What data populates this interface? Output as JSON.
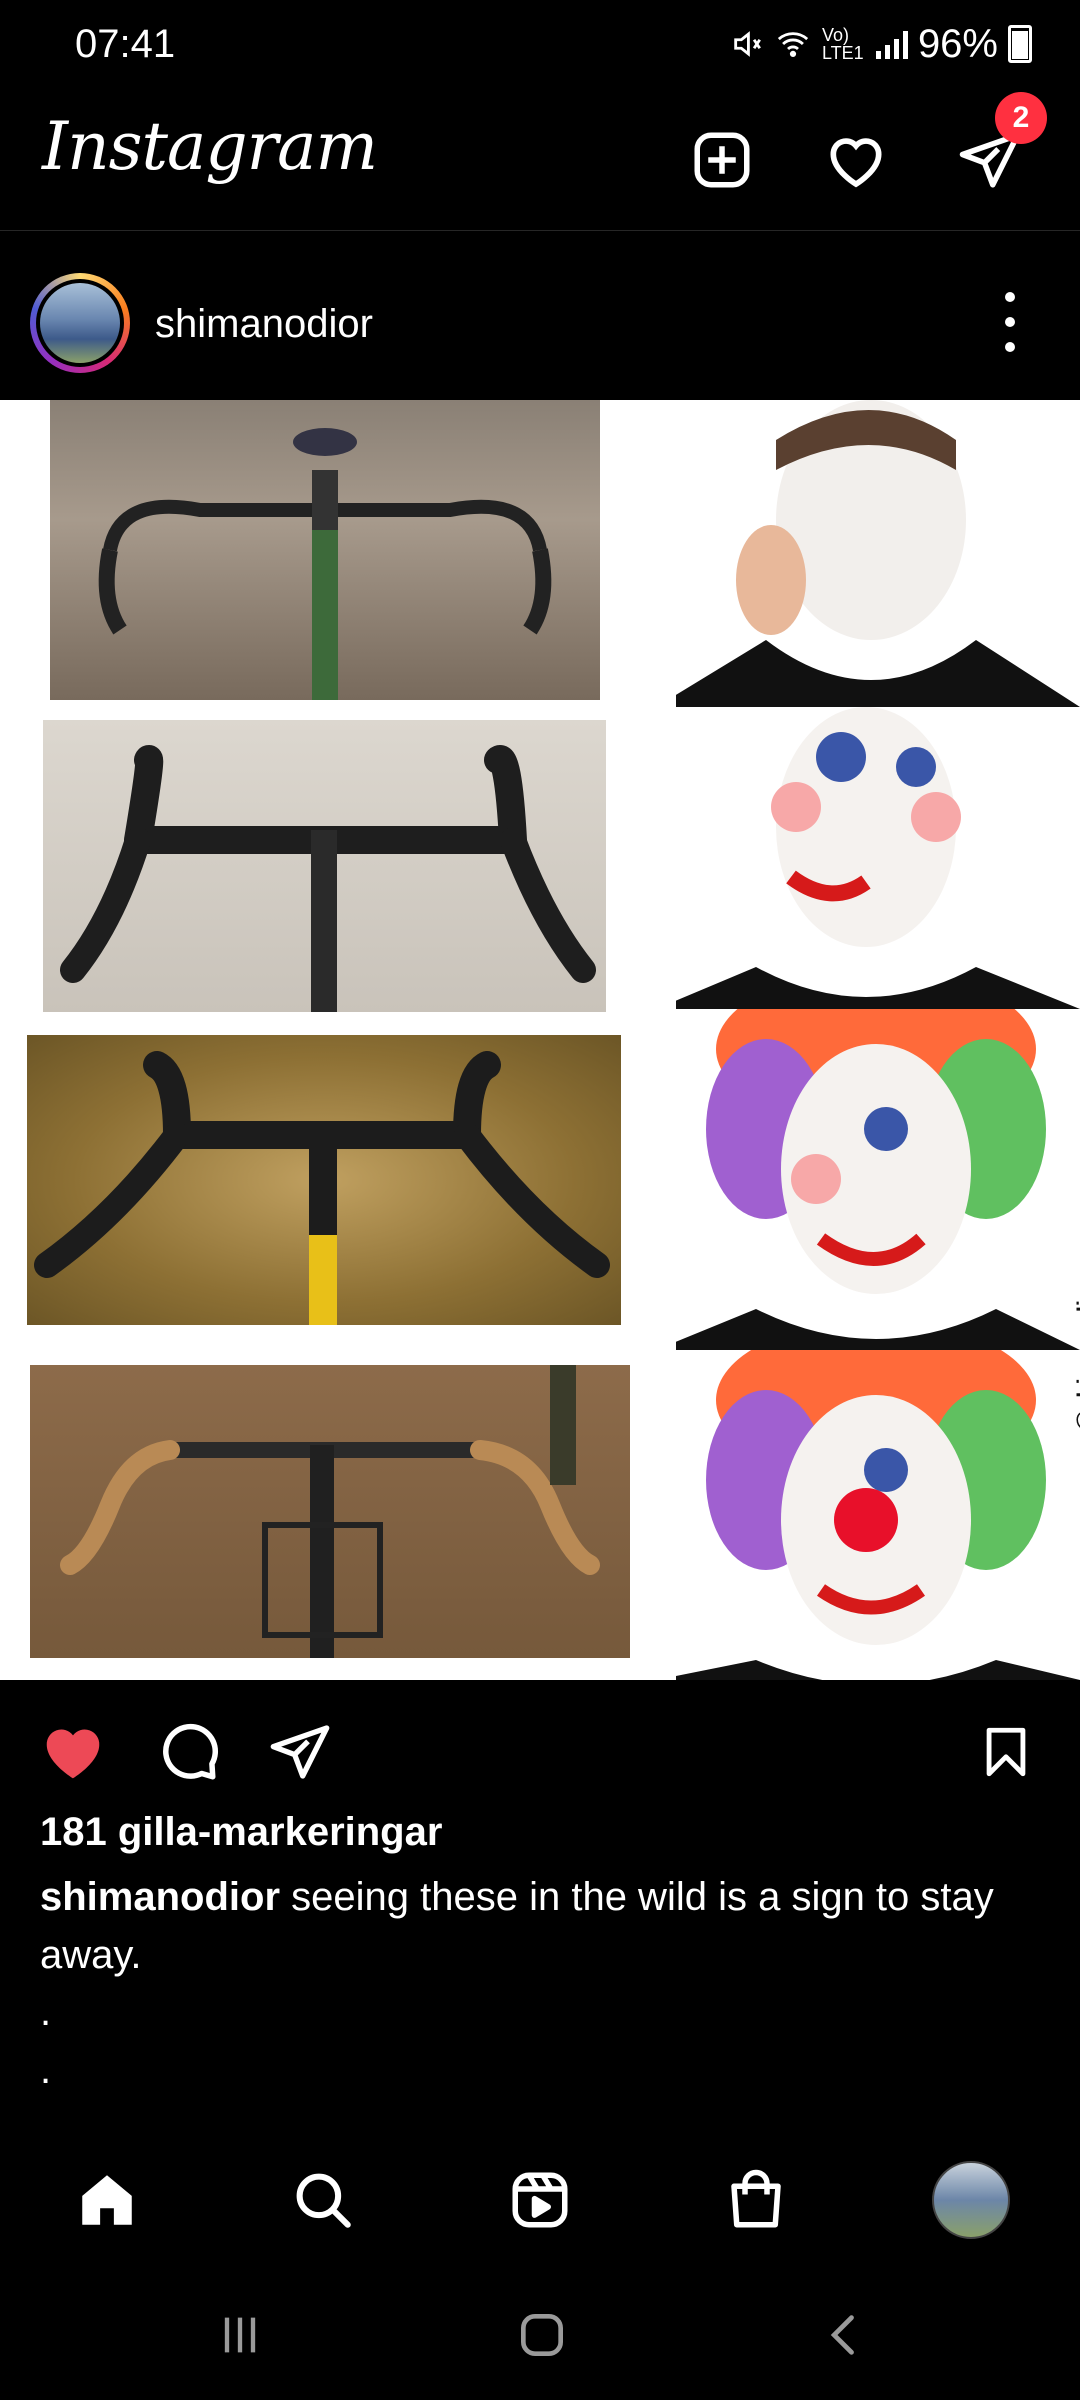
{
  "status_bar": {
    "time": "07:41",
    "network": "Vo) LTE1",
    "battery": "96%"
  },
  "header": {
    "logo": "Instagram",
    "notification_badge": "2",
    "icons": [
      "add-post-icon",
      "heart-icon",
      "direct-message-icon"
    ]
  },
  "post": {
    "username": "shimanodior",
    "watermark": "@shimanodior",
    "likes": "181 gilla-markeringar",
    "caption_user": "shimanodior",
    "caption_text": " seeing these in the wild is a sign to stay away.",
    "extra_lines": [
      ".",
      "."
    ],
    "liked": true
  },
  "bottom_nav": {
    "items": [
      "home-icon",
      "search-icon",
      "reels-icon",
      "shop-icon",
      "profile-avatar"
    ]
  },
  "colors": {
    "background": "#000000",
    "like_red": "#ed4956",
    "badge_red": "#ff3040"
  }
}
